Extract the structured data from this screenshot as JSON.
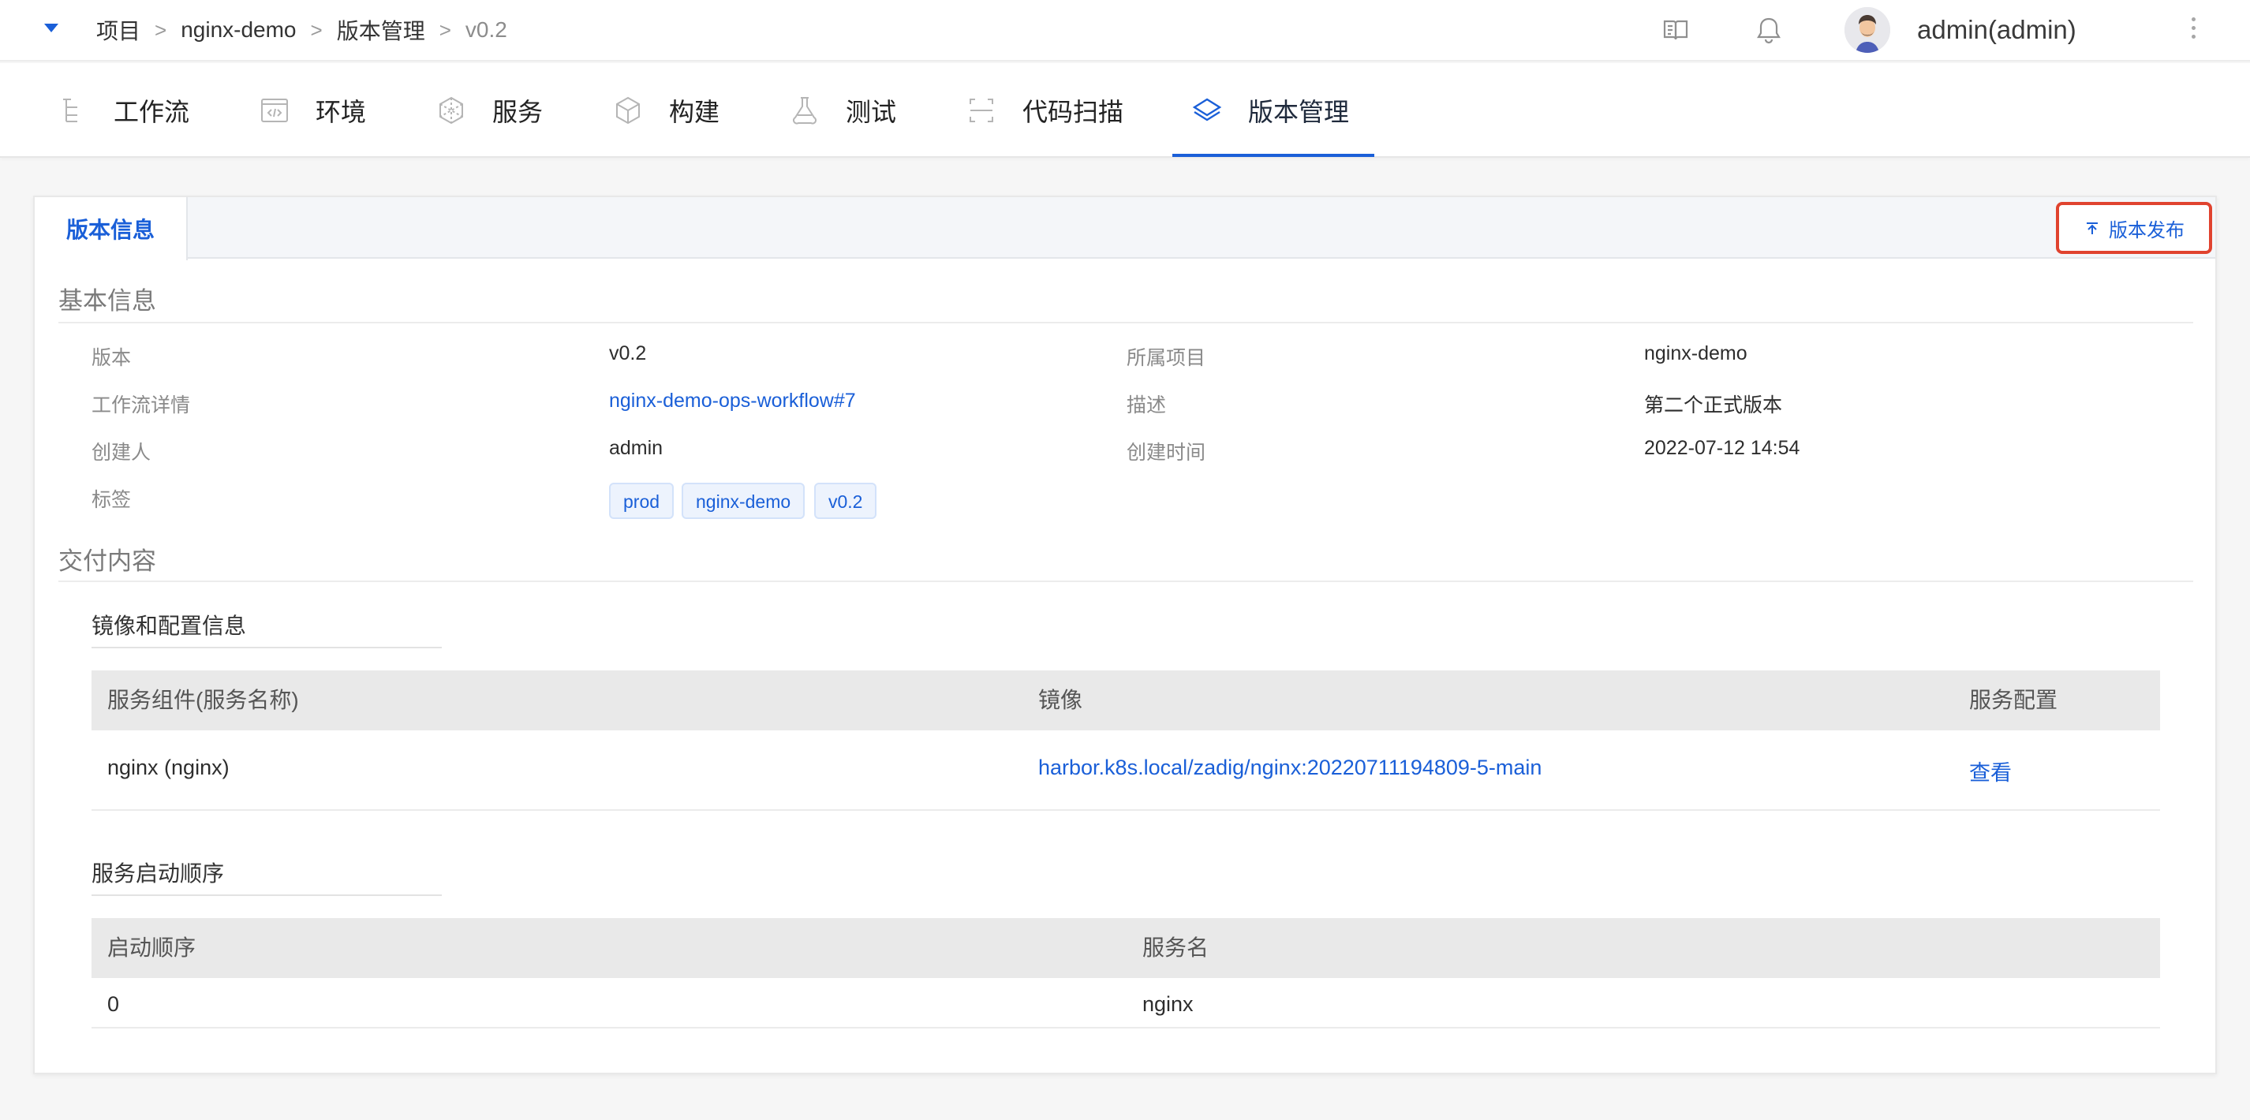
{
  "breadcrumb": {
    "items": [
      "项目",
      "nginx-demo",
      "版本管理"
    ],
    "current": "v0.2",
    "separator": ">"
  },
  "header": {
    "username": "admin(admin)",
    "icons": [
      "docs-icon",
      "bell-icon",
      "avatar",
      "more-vertical-icon"
    ]
  },
  "nav": {
    "items": [
      {
        "label": "工作流",
        "icon": "workflow-icon"
      },
      {
        "label": "环境",
        "icon": "environment-icon"
      },
      {
        "label": "服务",
        "icon": "service-icon"
      },
      {
        "label": "构建",
        "icon": "build-icon"
      },
      {
        "label": "测试",
        "icon": "test-icon"
      },
      {
        "label": "代码扫描",
        "icon": "scan-icon"
      },
      {
        "label": "版本管理",
        "icon": "version-icon"
      }
    ],
    "active": "版本管理"
  },
  "tabs": {
    "active_label": "版本信息",
    "release_button": "版本发布"
  },
  "basic_info": {
    "title": "基本信息",
    "version_label": "版本",
    "version_value": "v0.2",
    "project_label": "所属项目",
    "project_value": "nginx-demo",
    "workflow_label": "工作流详情",
    "workflow_value": "nginx-demo-ops-workflow#7",
    "desc_label": "描述",
    "desc_value": "第二个正式版本",
    "creator_label": "创建人",
    "creator_value": "admin",
    "created_label": "创建时间",
    "created_value": "2022-07-12 14:54",
    "tags_label": "标签",
    "tags": [
      "prod",
      "nginx-demo",
      "v0.2"
    ]
  },
  "delivery": {
    "title": "交付内容",
    "images_title": "镜像和配置信息",
    "images_columns": [
      "服务组件(服务名称)",
      "镜像",
      "服务配置"
    ],
    "images_rows": [
      {
        "service": "nginx (nginx)",
        "image": "harbor.k8s.local/zadig/nginx:20220711194809-5-main",
        "config": "查看"
      }
    ],
    "order_title": "服务启动顺序",
    "order_columns": [
      "启动顺序",
      "服务名"
    ],
    "order_rows": [
      {
        "order": "0",
        "name": "nginx"
      }
    ]
  },
  "colors": {
    "accent": "#1a5fd8",
    "highlight_border": "#e0432f"
  }
}
